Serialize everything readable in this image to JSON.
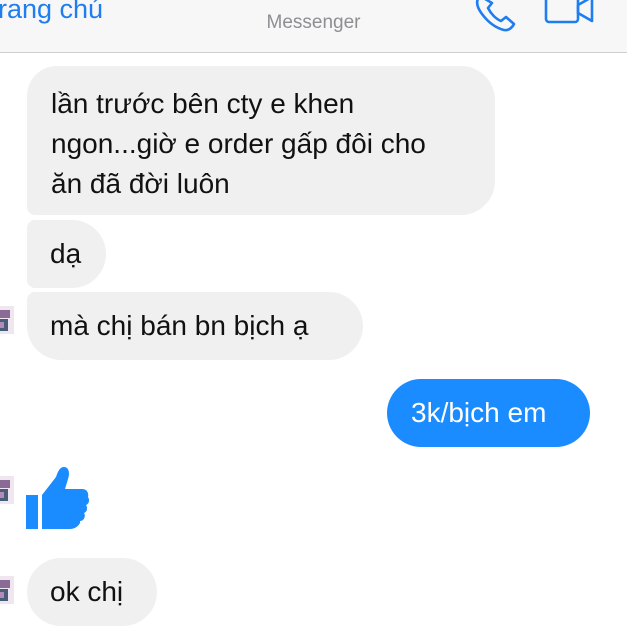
{
  "header": {
    "back_label": "rang chú",
    "subtitle": "Messenger",
    "call_icon": "phone-icon",
    "video_icon": "video-camera-icon",
    "accent": "#1e7ef0"
  },
  "messages": [
    {
      "from": "contact",
      "text_lines": [
        "lần trước bên cty e khen",
        "ngon...giờ e order gấp đôi cho",
        "ăn đã đời luôn"
      ]
    },
    {
      "from": "contact",
      "text": "dạ"
    },
    {
      "from": "contact",
      "text": "mà chị bán bn bịch ạ"
    },
    {
      "from": "me",
      "text": "3k/bịch em"
    },
    {
      "from": "contact",
      "sticker": "thumbs-up-icon"
    },
    {
      "from": "contact",
      "text": "ok chị"
    }
  ],
  "colors": {
    "incoming_bubble": "#f1f0f0",
    "outgoing_bubble": "#1a8cff",
    "like": "#1a8cff"
  }
}
